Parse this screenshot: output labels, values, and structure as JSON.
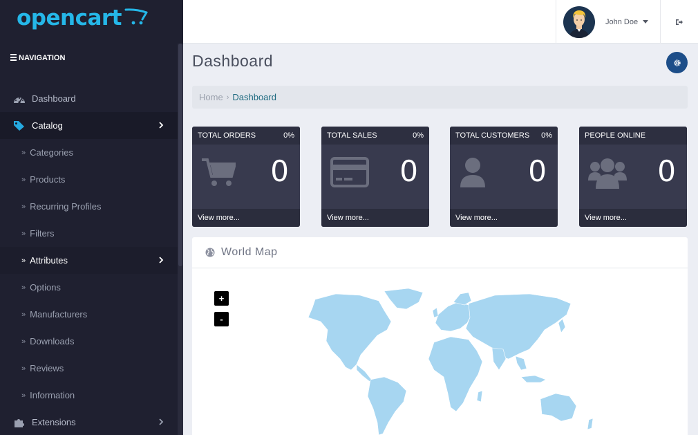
{
  "app": {
    "logo_text": "opencart"
  },
  "sidebar": {
    "heading": "NAVIGATION",
    "items": [
      {
        "label": "Dashboard",
        "icon": "dashboard-icon",
        "level": "top"
      },
      {
        "label": "Catalog",
        "icon": "tag-icon",
        "level": "top",
        "active": true,
        "expandable": true
      },
      {
        "label": "Categories",
        "level": "sub"
      },
      {
        "label": "Products",
        "level": "sub"
      },
      {
        "label": "Recurring Profiles",
        "level": "sub"
      },
      {
        "label": "Filters",
        "level": "sub"
      },
      {
        "label": "Attributes",
        "level": "sub",
        "selected": true,
        "expandable": true
      },
      {
        "label": "Options",
        "level": "sub"
      },
      {
        "label": "Manufacturers",
        "level": "sub"
      },
      {
        "label": "Downloads",
        "level": "sub"
      },
      {
        "label": "Reviews",
        "level": "sub"
      },
      {
        "label": "Information",
        "level": "sub"
      },
      {
        "label": "Extensions",
        "icon": "puzzle-icon",
        "level": "top",
        "expandable": true
      }
    ]
  },
  "header": {
    "user_name": "John Doe",
    "logout_icon": "sign-out-icon"
  },
  "page": {
    "title": "Dashboard",
    "breadcrumb": {
      "home": "Home",
      "separator": "›",
      "current": "Dashboard"
    }
  },
  "tiles": [
    {
      "title": "TOTAL ORDERS",
      "percent": "0%",
      "value": "0",
      "footer": "View more...",
      "icon": "shopping-cart-icon"
    },
    {
      "title": "TOTAL SALES",
      "percent": "0%",
      "value": "0",
      "footer": "View more...",
      "icon": "credit-card-icon"
    },
    {
      "title": "TOTAL CUSTOMERS",
      "percent": "0%",
      "value": "0",
      "footer": "View more...",
      "icon": "user-icon"
    },
    {
      "title": "PEOPLE ONLINE",
      "percent": "",
      "value": "0",
      "footer": "View more...",
      "icon": "users-icon"
    }
  ],
  "map": {
    "title": "World Map",
    "zoom_in": "+",
    "zoom_out": "-"
  },
  "colors": {
    "sidebar_bg": "#1f2030",
    "accent_blue": "#1d4e89",
    "logo_blue": "#25b7e8",
    "tile_bg": "#383a4e",
    "map_land": "#a7d6f1"
  }
}
